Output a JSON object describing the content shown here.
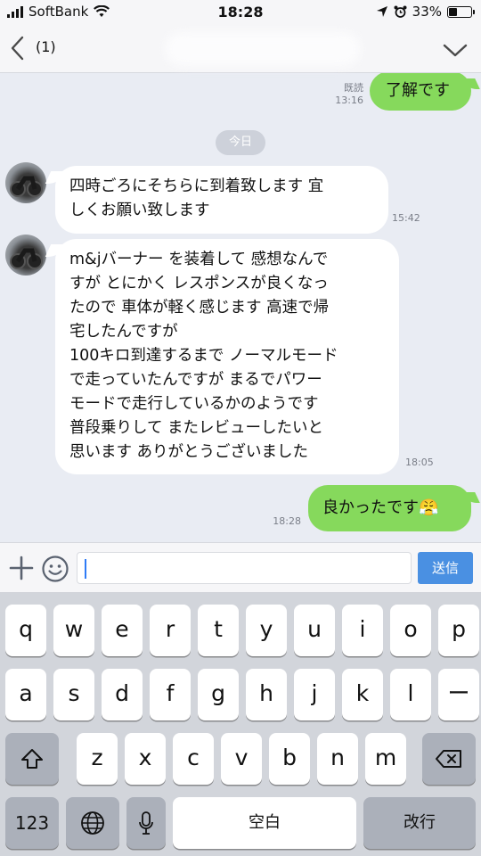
{
  "status_bar": {
    "carrier": "SoftBank",
    "time": "18:28",
    "battery": "33%",
    "battery_level": 0.33
  },
  "header": {
    "title": "(1)"
  },
  "messages": [
    {
      "dir": "out",
      "text": "了解です",
      "read": "既読",
      "time": "13:16"
    },
    {
      "dir": "in",
      "lines": [
        "四時ごろにそちらに到着致します 宜",
        "しくお願い致します"
      ],
      "time": "15:42"
    },
    {
      "dir": "in",
      "lines": [
        "m&jバーナー を装着して 感想なんで",
        "すが とにかく レスポンスが良くなっ",
        "たので 車体が軽く感じます 高速で帰",
        "宅したんですが",
        "100キロ到達するまで ノーマルモード",
        "で走っていたんですが まるでパワー",
        "モードで走行しているかのようです",
        "普段乗りして またレビューしたいと",
        "思います ありがとうございました"
      ],
      "time": "18:05"
    },
    {
      "dir": "out",
      "text": "良かったです",
      "emoji": "😤",
      "time": "18:28"
    }
  ],
  "date_divider": "今日",
  "input": {
    "value": "",
    "send_label": "送信"
  },
  "keyboard": {
    "row1": [
      "q",
      "w",
      "e",
      "r",
      "t",
      "y",
      "u",
      "i",
      "o",
      "p"
    ],
    "row2": [
      "a",
      "s",
      "d",
      "f",
      "g",
      "h",
      "j",
      "k",
      "l",
      "ー"
    ],
    "row3": [
      "z",
      "x",
      "c",
      "v",
      "b",
      "n",
      "m"
    ],
    "numbers_label": "123",
    "space_label": "空白",
    "return_label": "改行"
  },
  "icons": {
    "back": "chevron-left-icon",
    "menu": "chevron-down-icon",
    "plus": "plus-icon",
    "emoji": "smiley-icon",
    "shift": "shift-icon",
    "delete": "delete-icon",
    "globe": "globe-icon",
    "mic": "microphone-icon"
  },
  "colors": {
    "outgoing_bubble": "#86d95c",
    "incoming_bubble": "#ffffff",
    "chat_bg": "#e9ecf3",
    "send_button": "#4a90e2"
  }
}
